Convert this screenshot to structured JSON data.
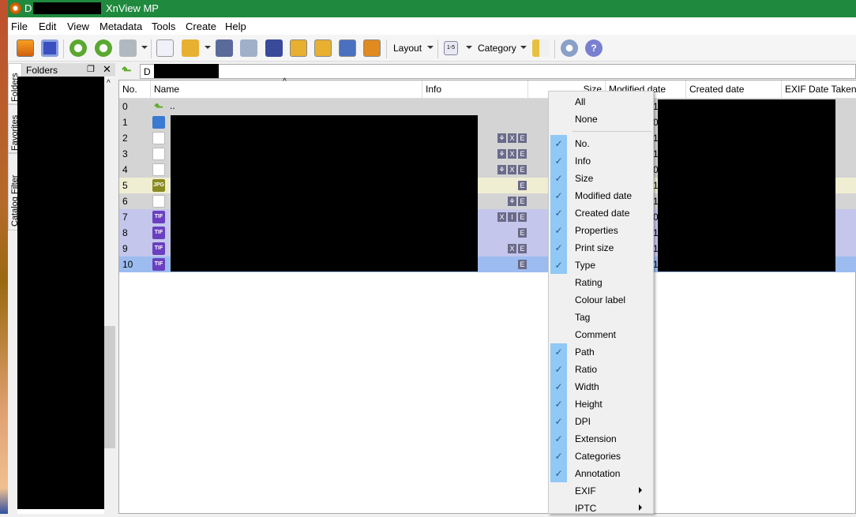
{
  "window": {
    "title": "XnView MP",
    "title_prefix": "D"
  },
  "menubar": [
    "File",
    "Edit",
    "View",
    "Metadata",
    "Tools",
    "Create",
    "Help"
  ],
  "toolbar": {
    "layout_label": "Layout",
    "category_label": "Category",
    "rating_icon_text": "1-5"
  },
  "side_tabs": [
    "Folders",
    "Favorites",
    "Catalog Filter"
  ],
  "folders_panel": {
    "title": "Folders"
  },
  "address": {
    "value": "D"
  },
  "columns": [
    "No.",
    "Name",
    "Info",
    "Size",
    "Modified date",
    "Created date",
    "EXIF Date Taken"
  ],
  "rows": [
    {
      "no": "0",
      "name": "..",
      "type": "up",
      "info": [],
      "md": "1"
    },
    {
      "no": "1",
      "name": "",
      "type": "img",
      "info": [],
      "md": "0"
    },
    {
      "no": "2",
      "name": "",
      "type": "pdf",
      "info": [
        "⚘",
        "X",
        "E"
      ],
      "md": "1"
    },
    {
      "no": "3",
      "name": "",
      "type": "pdf",
      "info": [
        "⚘",
        "X",
        "E"
      ],
      "md": "1"
    },
    {
      "no": "4",
      "name": "",
      "type": "pdf",
      "info": [
        "⚘",
        "X",
        "E"
      ],
      "md": "0"
    },
    {
      "no": "5",
      "name": "",
      "type": "jpg",
      "info": [
        "E"
      ],
      "md": "1"
    },
    {
      "no": "6",
      "name": "",
      "type": "pdf",
      "info": [
        "⚘",
        "E"
      ],
      "md": "1"
    },
    {
      "no": "7",
      "name": "",
      "type": "tif",
      "info": [
        "X",
        "I",
        "E"
      ],
      "md": "0"
    },
    {
      "no": "8",
      "name": "",
      "type": "tif",
      "info": [
        "E"
      ],
      "md": "1"
    },
    {
      "no": "9",
      "name": "",
      "type": "tif",
      "info": [
        "X",
        "E"
      ],
      "md": "1"
    },
    {
      "no": "10",
      "name": "",
      "type": "tif",
      "info": [
        "E"
      ],
      "md": "1"
    }
  ],
  "icon_labels": {
    "jpg": "JPG",
    "tif": "TIF"
  },
  "colors": {
    "gray": "#d4d4d4",
    "jpg": "#f0eed2",
    "tif": "#c4c6ec",
    "selected": "#9cbcf0",
    "title": "#1f8a3e"
  },
  "context_menu": {
    "top": [
      "All",
      "None"
    ],
    "items": [
      {
        "label": "No.",
        "checked": true
      },
      {
        "label": "Info",
        "checked": true
      },
      {
        "label": "Size",
        "checked": true
      },
      {
        "label": "Modified date",
        "checked": true
      },
      {
        "label": "Created date",
        "checked": true
      },
      {
        "label": "Properties",
        "checked": true
      },
      {
        "label": "Print size",
        "checked": true
      },
      {
        "label": "Type",
        "checked": true
      },
      {
        "label": "Rating",
        "checked": false
      },
      {
        "label": "Colour label",
        "checked": false
      },
      {
        "label": "Tag",
        "checked": false
      },
      {
        "label": "Comment",
        "checked": false
      },
      {
        "label": "Path",
        "checked": true
      },
      {
        "label": "Ratio",
        "checked": true
      },
      {
        "label": "Width",
        "checked": true
      },
      {
        "label": "Height",
        "checked": true
      },
      {
        "label": "DPI",
        "checked": true
      },
      {
        "label": "Extension",
        "checked": true
      },
      {
        "label": "Categories",
        "checked": true
      },
      {
        "label": "Annotation",
        "checked": true
      },
      {
        "label": "EXIF",
        "checked": false,
        "submenu": true
      },
      {
        "label": "IPTC",
        "checked": false,
        "submenu": true
      }
    ]
  }
}
